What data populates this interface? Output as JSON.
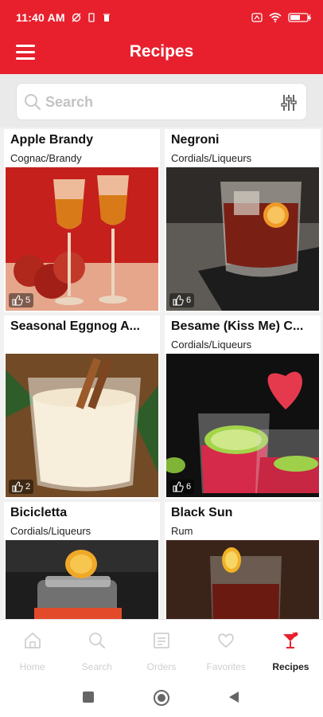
{
  "status_bar": {
    "time": "11:40 AM"
  },
  "app_bar": {
    "title": "Recipes"
  },
  "search": {
    "placeholder": "Search"
  },
  "recipes": [
    {
      "name": "Apple Brandy",
      "category": "Cognac/Brandy",
      "likes": "5"
    },
    {
      "name": "Negroni",
      "category": "Cordials/Liqueurs",
      "likes": "6"
    },
    {
      "name": "Seasonal Eggnog A...",
      "category": "",
      "likes": "2"
    },
    {
      "name": "Besame (Kiss Me) C...",
      "category": "Cordials/Liqueurs",
      "likes": "6"
    },
    {
      "name": "Bicicletta",
      "category": "Cordials/Liqueurs",
      "likes": ""
    },
    {
      "name": "Black Sun",
      "category": "Rum",
      "likes": ""
    }
  ],
  "bottom_nav": [
    {
      "label": "Home",
      "icon": "home-icon"
    },
    {
      "label": "Search",
      "icon": "search-icon"
    },
    {
      "label": "Orders",
      "icon": "orders-icon"
    },
    {
      "label": "Favorites",
      "icon": "heart-icon"
    },
    {
      "label": "Recipes",
      "icon": "cocktail-icon",
      "active": true
    }
  ],
  "colors": {
    "brand_red": "#e8202e",
    "inactive_gray": "#cfcfcf"
  }
}
